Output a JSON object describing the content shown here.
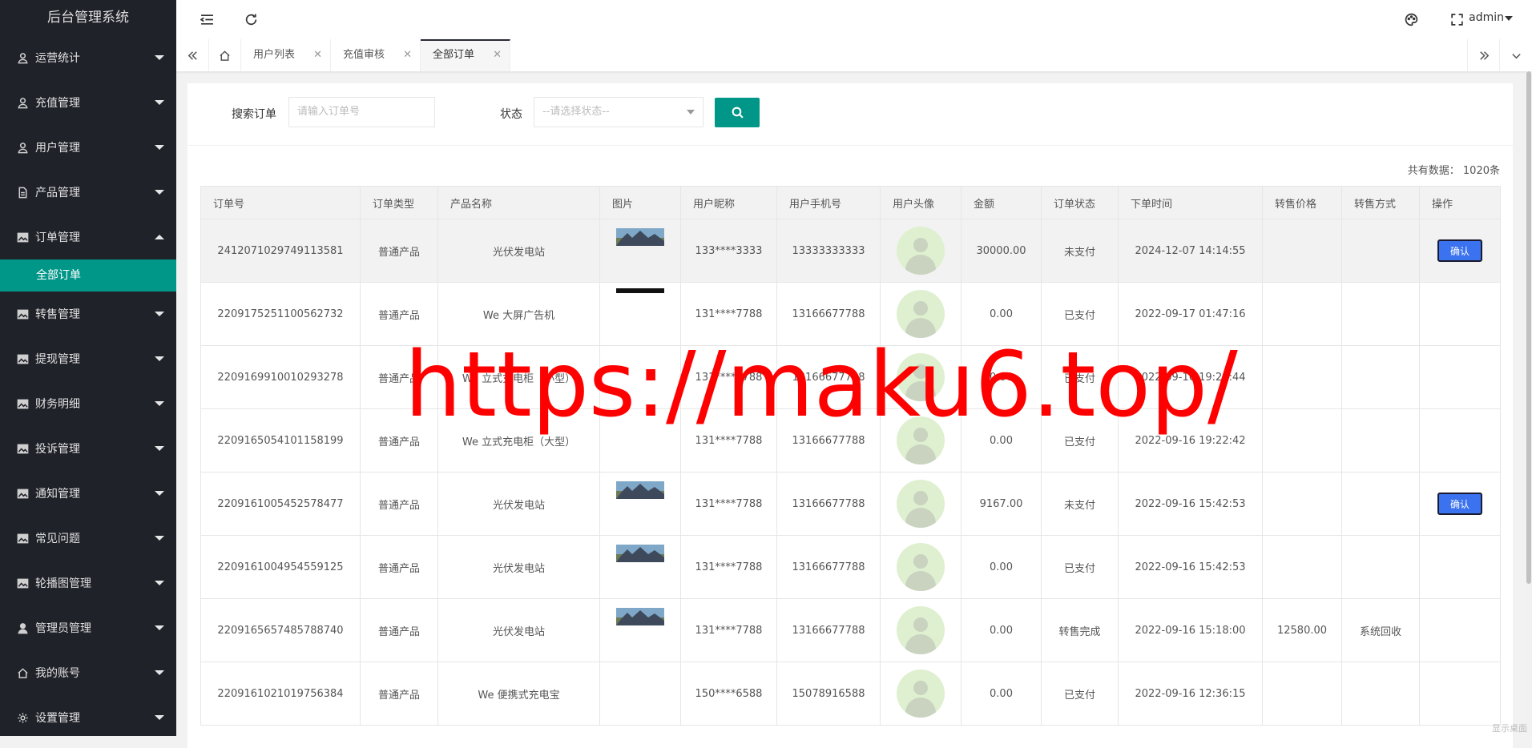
{
  "app": {
    "title": "后台管理系统"
  },
  "sidebar": {
    "items": [
      {
        "label": "运营统计",
        "icon": "user-icon"
      },
      {
        "label": "充值管理",
        "icon": "user-icon"
      },
      {
        "label": "用户管理",
        "icon": "user-icon"
      },
      {
        "label": "产品管理",
        "icon": "file-icon"
      },
      {
        "label": "订单管理",
        "icon": "image-icon",
        "expanded": true
      },
      {
        "label": "转售管理",
        "icon": "image-icon"
      },
      {
        "label": "提现管理",
        "icon": "image-icon"
      },
      {
        "label": "财务明细",
        "icon": "image-icon"
      },
      {
        "label": "投诉管理",
        "icon": "image-icon"
      },
      {
        "label": "通知管理",
        "icon": "image-icon"
      },
      {
        "label": "常见问题",
        "icon": "image-icon"
      },
      {
        "label": "轮播图管理",
        "icon": "image-icon"
      },
      {
        "label": "管理员管理",
        "icon": "person-icon"
      },
      {
        "label": "我的账号",
        "icon": "home-icon"
      },
      {
        "label": "设置管理",
        "icon": "gear-icon"
      }
    ],
    "subitem": "全部订单"
  },
  "header": {
    "user": "admin"
  },
  "tabs": [
    {
      "label": "用户列表"
    },
    {
      "label": "充值审核"
    },
    {
      "label": "全部订单",
      "active": true
    }
  ],
  "search": {
    "order_label": "搜索订单",
    "order_placeholder": "请输入订单号",
    "status_label": "状态",
    "status_placeholder": "--请选择状态--"
  },
  "total": "共有数据： 1020条",
  "table": {
    "headers": [
      "订单号",
      "订单类型",
      "产品名称",
      "图片",
      "用户昵称",
      "用户手机号",
      "用户头像",
      "金额",
      "订单状态",
      "下单时间",
      "转售价格",
      "转售方式",
      "操作"
    ],
    "rows": [
      {
        "id": "2412071029749113581",
        "type": "普通产品",
        "product": "光伏发电站",
        "img": "photo",
        "nick": "133****3333",
        "phone": "13333333333",
        "amount": "30000.00",
        "status": "未支付",
        "time": "2024-12-07 14:14:55",
        "resale_price": "",
        "resale_method": "",
        "action": "确认"
      },
      {
        "id": "2209175251100562732",
        "type": "普通产品",
        "product": "We 大屏广告机",
        "img": "dark",
        "nick": "131****7788",
        "phone": "13166677788",
        "amount": "0.00",
        "status": "已支付",
        "time": "2022-09-17 01:47:16",
        "resale_price": "",
        "resale_method": "",
        "action": ""
      },
      {
        "id": "2209169910010293278",
        "type": "普通产品",
        "product": "We 立式充电柜（小型）",
        "img": "",
        "nick": "131****7788",
        "phone": "13166677788",
        "amount": "0.00",
        "status": "已支付",
        "time": "2022-09-16 19:24:44",
        "resale_price": "",
        "resale_method": "",
        "action": ""
      },
      {
        "id": "2209165054101158199",
        "type": "普通产品",
        "product": "We 立式充电柜（大型）",
        "img": "",
        "nick": "131****7788",
        "phone": "13166677788",
        "amount": "0.00",
        "status": "已支付",
        "time": "2022-09-16 19:22:42",
        "resale_price": "",
        "resale_method": "",
        "action": ""
      },
      {
        "id": "2209161005452578477",
        "type": "普通产品",
        "product": "光伏发电站",
        "img": "photo",
        "nick": "131****7788",
        "phone": "13166677788",
        "amount": "9167.00",
        "status": "未支付",
        "time": "2022-09-16 15:42:53",
        "resale_price": "",
        "resale_method": "",
        "action": "确认"
      },
      {
        "id": "2209161004954559125",
        "type": "普通产品",
        "product": "光伏发电站",
        "img": "photo",
        "nick": "131****7788",
        "phone": "13166677788",
        "amount": "0.00",
        "status": "已支付",
        "time": "2022-09-16 15:42:53",
        "resale_price": "",
        "resale_method": "",
        "action": ""
      },
      {
        "id": "2209165657485788740",
        "type": "普通产品",
        "product": "光伏发电站",
        "img": "photo",
        "nick": "131****7788",
        "phone": "13166677788",
        "amount": "0.00",
        "status": "转售完成",
        "time": "2022-09-16 15:18:00",
        "resale_price": "12580.00",
        "resale_method": "系统回收",
        "action": ""
      },
      {
        "id": "2209161021019756384",
        "type": "普通产品",
        "product": "We 便携式充电宝",
        "img": "",
        "nick": "150****6588",
        "phone": "15078916588",
        "amount": "0.00",
        "status": "已支付",
        "time": "2022-09-16 12:36:15",
        "resale_price": "",
        "resale_method": "",
        "action": ""
      }
    ]
  },
  "watermark": "https://maku6.top/",
  "corner": "显示桌面",
  "colors": {
    "sidebar_bg": "#20222a",
    "accent": "#009688",
    "confirm": "#3b72f0",
    "watermark": "#ff0000"
  }
}
